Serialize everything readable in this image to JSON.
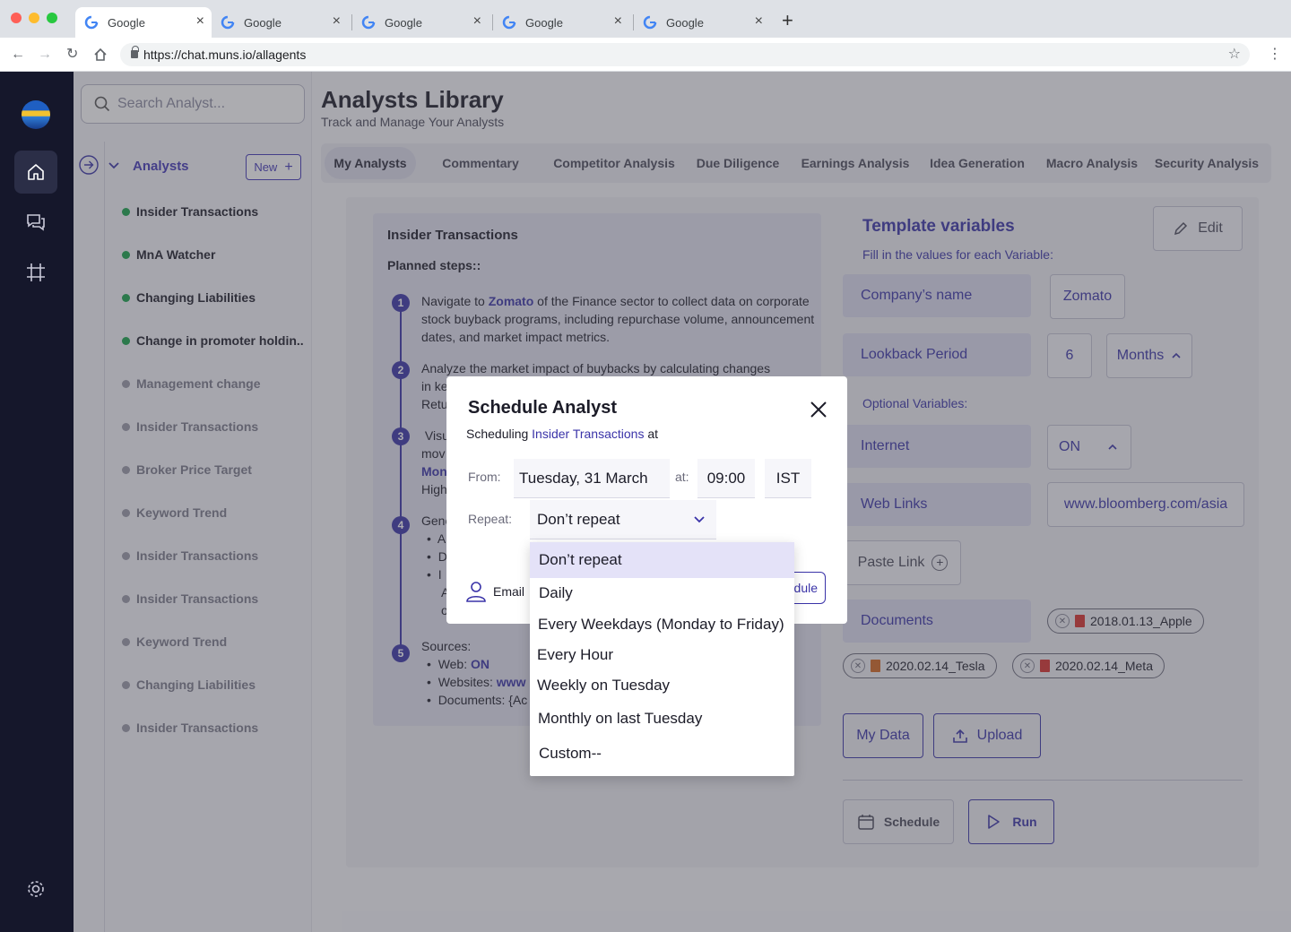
{
  "browser": {
    "tabs": [
      {
        "title": "Google"
      },
      {
        "title": "Google"
      },
      {
        "title": "Google"
      },
      {
        "title": "Google"
      },
      {
        "title": "Google"
      }
    ],
    "url": "https://chat.muns.io/allagents"
  },
  "sidebar": {
    "search_placeholder": "Search Analyst...",
    "section_label": "Analysts",
    "new_label": "New",
    "items": [
      {
        "label": "Insider Transactions",
        "active": true
      },
      {
        "label": "MnA Watcher",
        "active": true
      },
      {
        "label": "Changing Liabilities",
        "active": true
      },
      {
        "label": "Change in promoter holdin..",
        "active": true
      },
      {
        "label": "Management change",
        "active": false
      },
      {
        "label": "Insider Transactions",
        "active": false
      },
      {
        "label": "Broker Price Target",
        "active": false
      },
      {
        "label": "Keyword Trend",
        "active": false
      },
      {
        "label": "Insider Transactions",
        "active": false
      },
      {
        "label": "Insider Transactions",
        "active": false
      },
      {
        "label": "Keyword Trend",
        "active": false
      },
      {
        "label": "Changing Liabilities",
        "active": false
      },
      {
        "label": "Insider Transactions",
        "active": false
      }
    ],
    "colors": {
      "active_dot": "#16a34a",
      "inactive_dot": "#9a9aa8"
    }
  },
  "header": {
    "title": "Analysts Library",
    "subtitle": "Track and Manage Your Analysts"
  },
  "page_tabs": [
    "My Analysts",
    "Commentary",
    "Competitor Analysis",
    "Due Diligence",
    "Earnings Analysis",
    "Idea Generation",
    "Macro Analysis",
    "Security Analysis"
  ],
  "steps_card": {
    "title": "Insider Transactions",
    "planned_label": "Planned steps::",
    "step1": {
      "pre": "Navigate to ",
      "link": "Zomato",
      "post": " of the Finance sector to collect data on corporate stock buyback programs, including repurchase volume, announcement dates, and market impact metrics."
    },
    "step2_l1": "Analyze the market impact of buybacks by calculating changes",
    "step2_l2": "in ke",
    "step2_l3": "Retu",
    "step3_l1": " Visu",
    "step3_l2": "mov",
    "step3_l3": "Mon",
    "step3_l4": "High",
    "step4_l1": "Gene",
    "step4_b1": "A",
    "step4_b2": "D",
    "step4_b3": "I",
    "step4_b3b": "A",
    "step4_b3c": "o",
    "sources_label": "Sources:",
    "src_web_label": "Web: ",
    "src_web_value": "ON",
    "src_sites_label": "Websites: ",
    "src_sites_value": "www",
    "src_docs": "Documents: {Ac"
  },
  "template_vars": {
    "title": "Template variables",
    "subtitle": "Fill in the values for each Variable:",
    "edit_label": "Edit",
    "company_label": "Company’s name",
    "company_value": "Zomato",
    "lookback_label": "Lookback Period",
    "lookback_value": "6",
    "lookback_unit": "Months",
    "optional_label": "Optional Variables:",
    "internet_label": "Internet",
    "internet_value": "ON",
    "weblinks_label": "Web Links",
    "weblinks_value": "www.bloomberg.com/asia",
    "paste_link_label": "Paste Link",
    "documents_label": "Documents",
    "documents": [
      "2018.01.13_Apple",
      "2020.02.14_Tesla",
      "2020.02.14_Meta"
    ],
    "my_data_label": "My Data",
    "upload_label": "Upload",
    "schedule_label": "Schedule",
    "run_label": "Run"
  },
  "modal": {
    "title": "Schedule Analyst",
    "sub_pre": "Scheduling ",
    "sub_link": "Insider Transactions",
    "sub_post": " at",
    "from_label": "From:",
    "date_value": "Tuesday, 31 March",
    "at_label": "at:",
    "time_value": "09:00",
    "tz_value": "IST",
    "repeat_label": "Repeat:",
    "repeat_value": "Don’t repeat",
    "email_label": "Email",
    "schedule_btn_fragment": "dule",
    "options": [
      "Don’t repeat",
      "Daily",
      "Every Weekdays (Monday to Friday)",
      "Every Hour",
      "Weekly on Tuesday",
      "Monthly on last Tuesday",
      "Custom--"
    ]
  },
  "colors": {
    "accent": "#3a33a8",
    "rail": "#15172b"
  }
}
